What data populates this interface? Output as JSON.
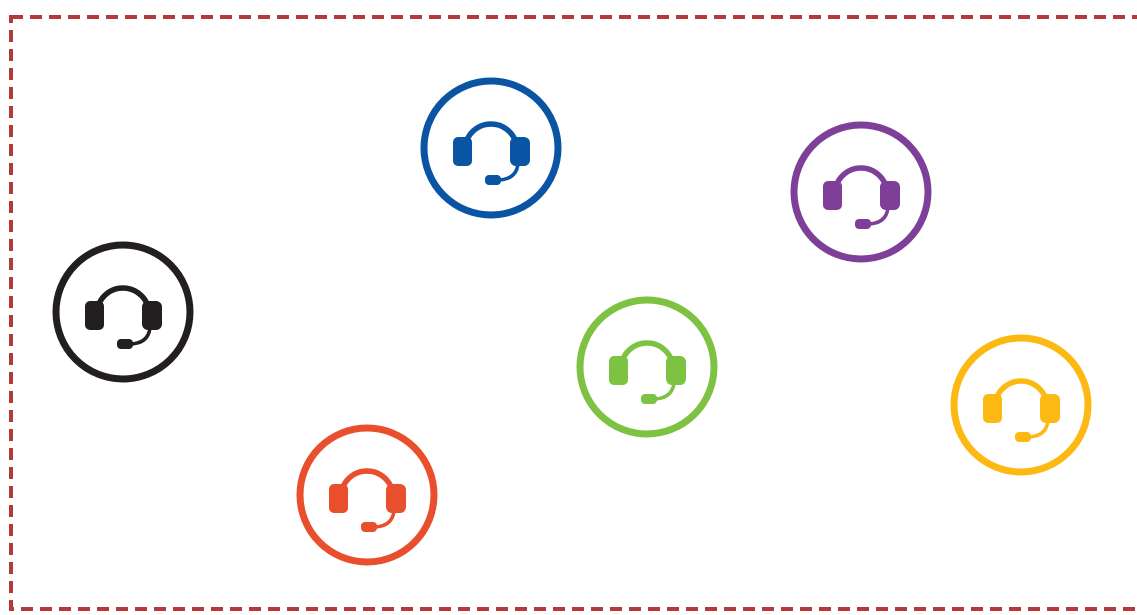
{
  "frame": {
    "border_color": "#B23A3A",
    "border_style": "dashed"
  },
  "headsets": [
    {
      "name": "headset-black",
      "color": "#231F20",
      "icon": "headset-icon"
    },
    {
      "name": "headset-blue",
      "color": "#0A54A4",
      "icon": "headset-icon"
    },
    {
      "name": "headset-purple",
      "color": "#7D3F98",
      "icon": "headset-icon"
    },
    {
      "name": "headset-green",
      "color": "#7DC242",
      "icon": "headset-icon"
    },
    {
      "name": "headset-yellow",
      "color": "#FDB913",
      "icon": "headset-icon"
    },
    {
      "name": "headset-orange",
      "color": "#E94E2D",
      "icon": "headset-icon"
    }
  ]
}
